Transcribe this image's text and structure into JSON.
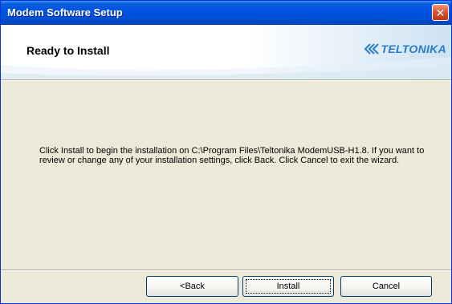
{
  "window": {
    "title": "Modem Software Setup",
    "close_glyph": "✕"
  },
  "header": {
    "title": "Ready to Install",
    "logo_text": "TELTONIKA",
    "logo_icon": "teltonika-chevrons-icon"
  },
  "body": {
    "message": "Click Install to begin the installation on C:\\Program Files\\Teltonika ModemUSB-H1.8. If you want to review or change any of your installation settings, click Back. Click Cancel to exit the wizard."
  },
  "buttons": {
    "back": "<Back",
    "install": "Install",
    "cancel": "Cancel"
  },
  "colors": {
    "titlebar": "#0054e3",
    "dialog_bg": "#ece9d8",
    "close_button": "#e25a36",
    "logo": "#2a7ac8"
  }
}
